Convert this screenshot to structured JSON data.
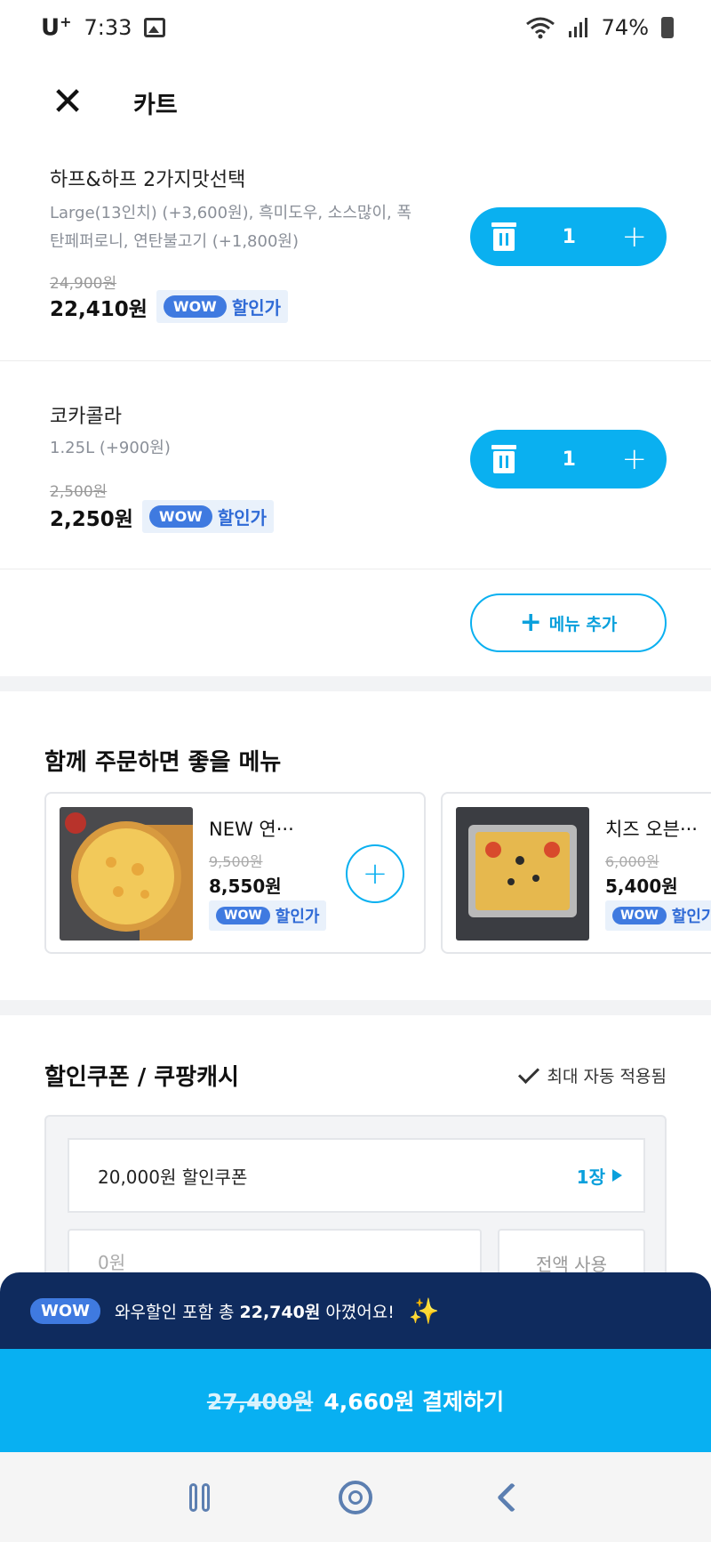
{
  "status_bar": {
    "carrier": "U",
    "carrier_sup": "+",
    "time": "7:33",
    "battery": "74%"
  },
  "header": {
    "title": "카트"
  },
  "cart_items": [
    {
      "name": "하프&하프 2가지맛선택",
      "options": "Large(13인치) (+3,600원), 흑미도우, 소스많이, 폭탄페퍼로니, 연탄불고기 (+1,800원)",
      "original_price": "24,900원",
      "price": "22,410원",
      "quantity": "1"
    },
    {
      "name": "코카콜라",
      "options": "1.25L (+900원)",
      "original_price": "2,500원",
      "price": "2,250원",
      "quantity": "1"
    }
  ],
  "wow": {
    "badge": "WOW",
    "discount_label": "할인가"
  },
  "add_menu_label": "메뉴 추가",
  "recommend": {
    "title": "함께 주문하면 좋을 메뉴",
    "items": [
      {
        "name": "NEW 연···",
        "original_price": "9,500원",
        "price": "8,550원"
      },
      {
        "name": "치즈 오븐···",
        "original_price": "6,000원",
        "price": "5,400원"
      }
    ]
  },
  "coupon": {
    "title": "할인쿠폰 / 쿠팡캐시",
    "auto_applied": "최대 자동 적용됨",
    "coupon_label": "20,000원 할인쿠폰",
    "coupon_count": "1장",
    "cash_value": "0원",
    "use_all_label": "전액 사용"
  },
  "banner": {
    "prefix": "와우할인 포함 총 ",
    "amount": "22,740원",
    "suffix": " 아꼈어요!"
  },
  "pay": {
    "original_total": "27,400원",
    "label": "4,660원 결제하기"
  },
  "colors": {
    "accent": "#08b0f2",
    "wow_blue": "#3f7ae0",
    "banner_navy": "#0f2b5e"
  }
}
